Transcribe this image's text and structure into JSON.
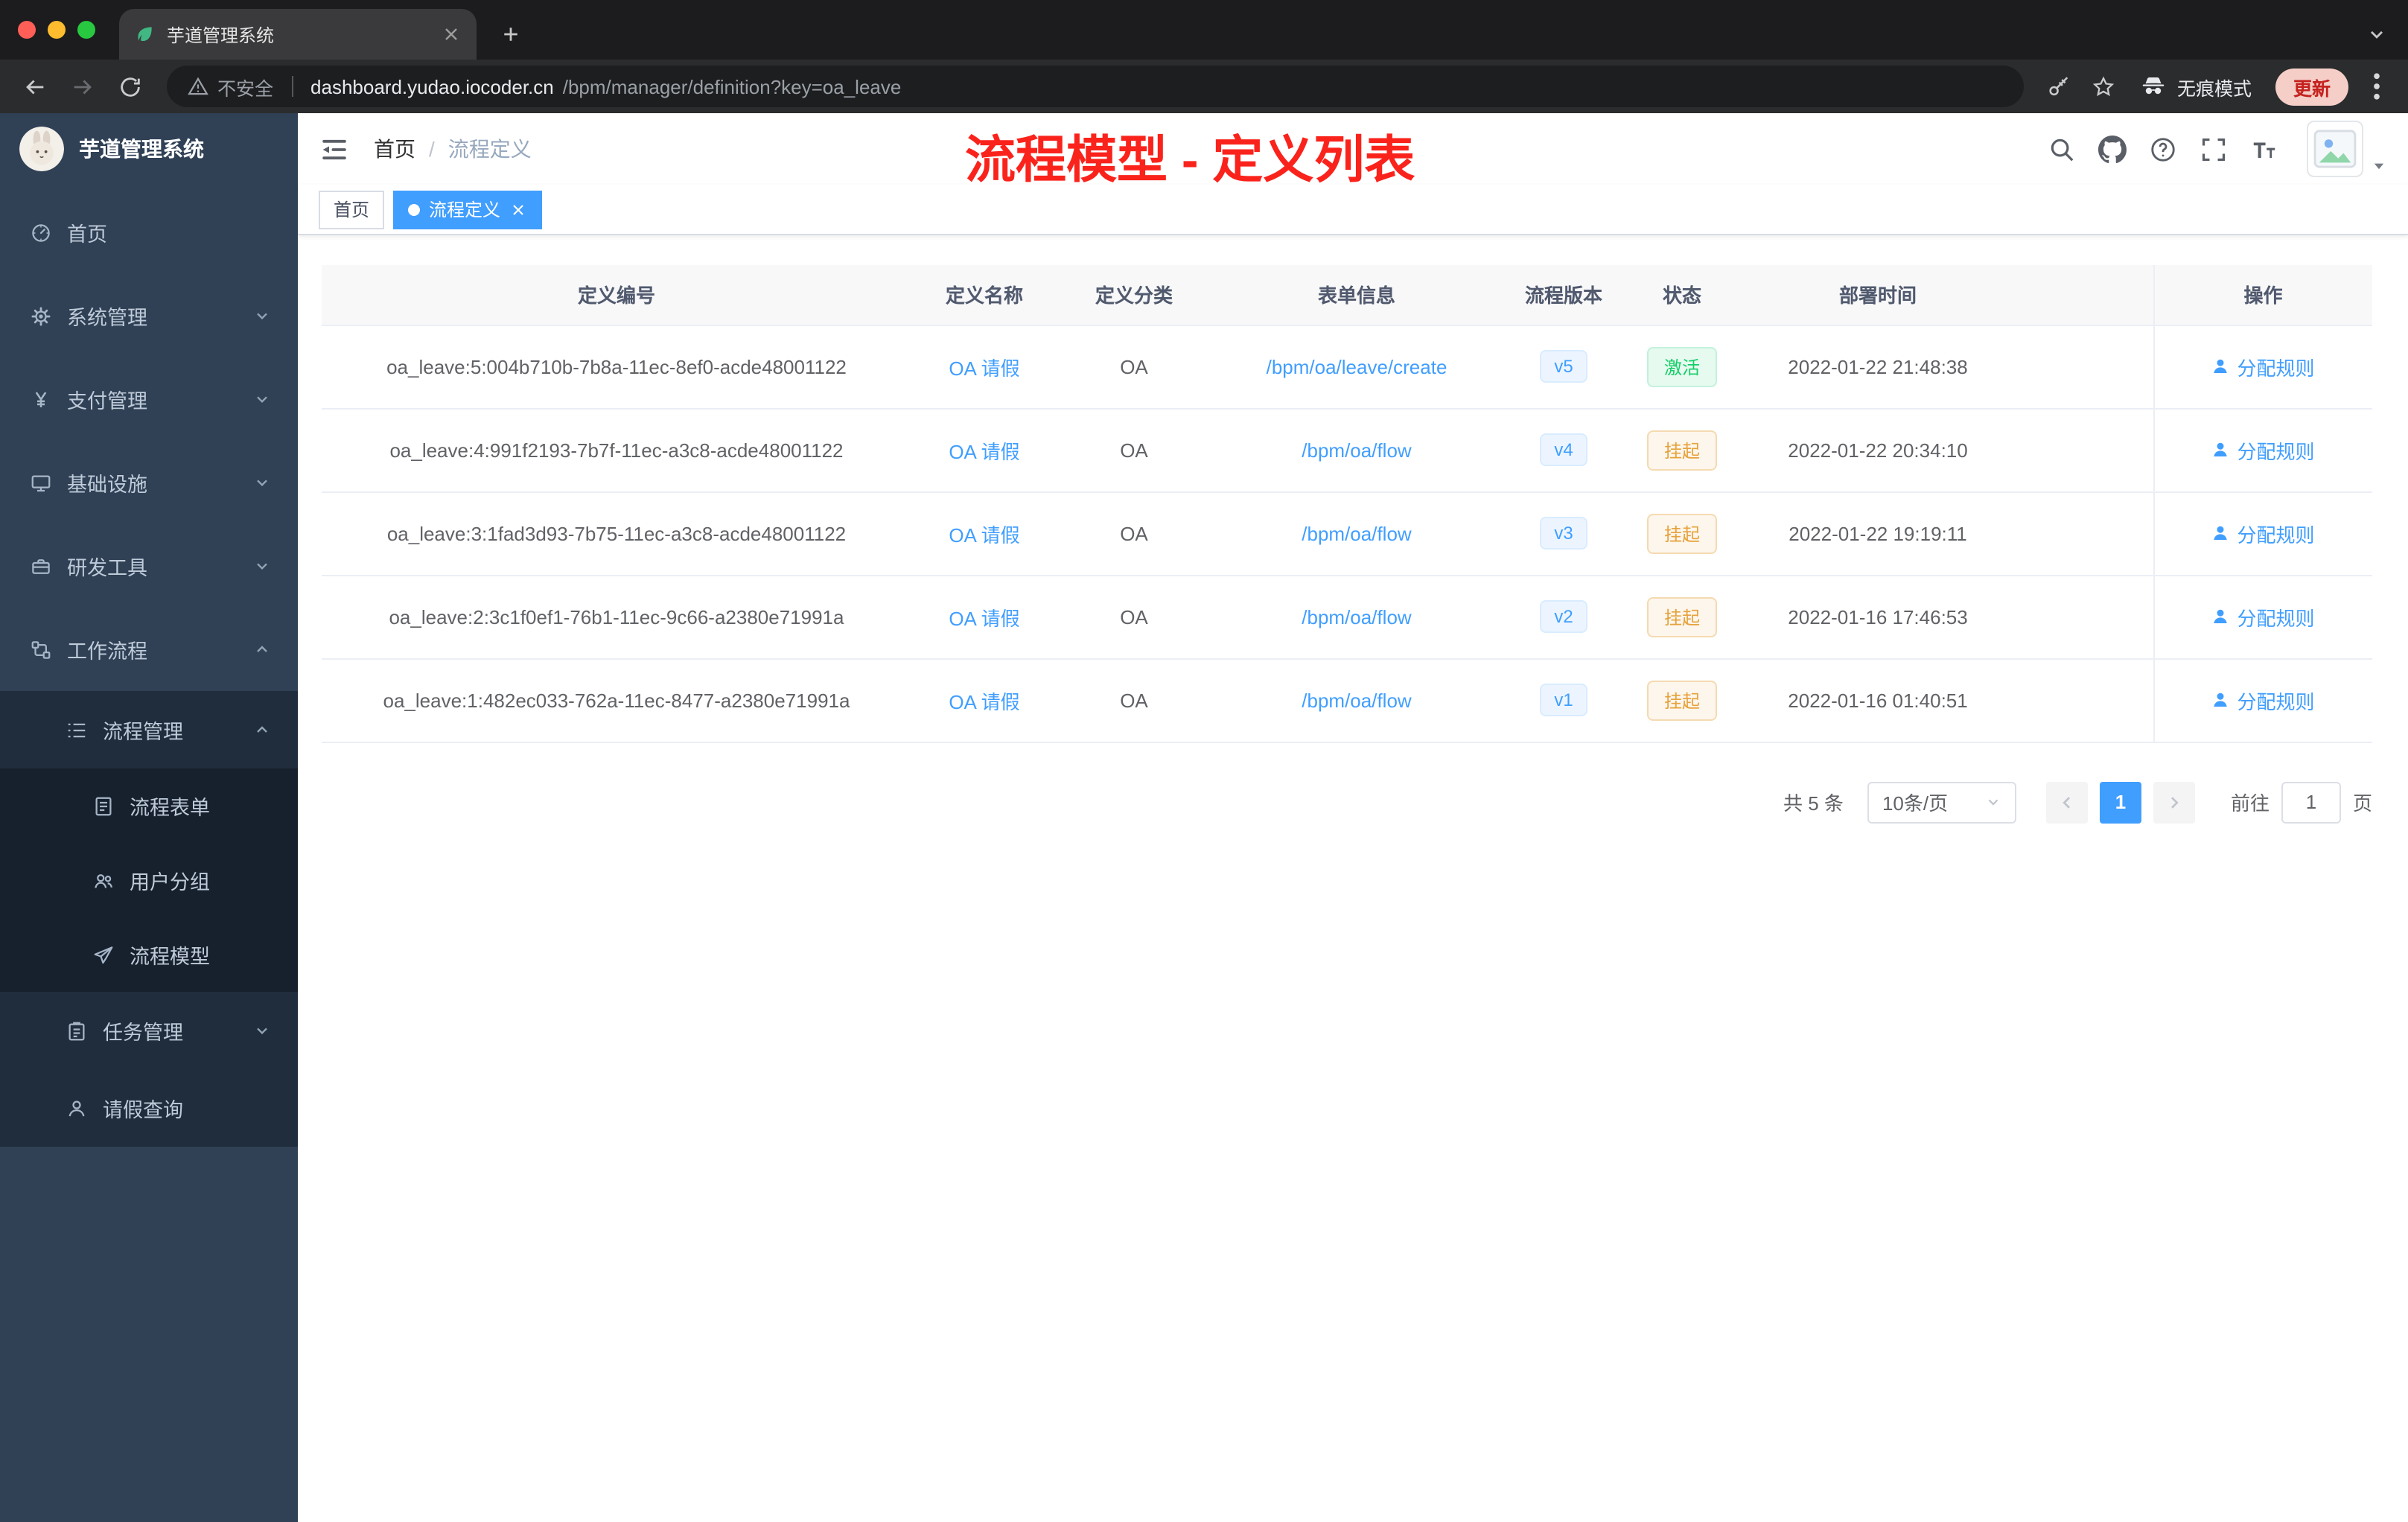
{
  "colors": {
    "accent": "#409eff",
    "sidebar_bg": "#304156",
    "submenu_bg": "#1f2d3d",
    "annotation_red": "#fa231c",
    "status_active_bg": "#e7faf0",
    "status_active_text": "#13ce66",
    "status_suspended_bg": "#fdf6ec",
    "status_suspended_text": "#e6a23c",
    "version_badge_bg": "#ecf5ff",
    "version_badge_text": "#409eff",
    "tag_active_bg": "#409eff"
  },
  "browser": {
    "tab_title": "芋道管理系统",
    "security_label": "不安全",
    "url_host": "dashboard.yudao.iocoder.cn",
    "url_path": "/bpm/manager/definition?key=oa_leave",
    "incognito_label": "无痕模式",
    "update_label": "更新"
  },
  "sidebar": {
    "logo_title": "芋道管理系统",
    "items": [
      {
        "key": "home",
        "label": "首页",
        "icon": "dashboard-icon",
        "level": 1
      },
      {
        "key": "system-management",
        "label": "系统管理",
        "icon": "gear-icon",
        "level": 1,
        "chevron": "down"
      },
      {
        "key": "payment-management",
        "label": "支付管理",
        "icon": "yen-icon",
        "level": 1,
        "chevron": "down"
      },
      {
        "key": "infrastructure",
        "label": "基础设施",
        "icon": "monitor-icon",
        "level": 1,
        "chevron": "down"
      },
      {
        "key": "dev-tools",
        "label": "研发工具",
        "icon": "toolbox-icon",
        "level": 1,
        "chevron": "down"
      },
      {
        "key": "workflow",
        "label": "工作流程",
        "icon": "workflow-icon",
        "level": 1,
        "chevron": "up"
      },
      {
        "key": "process-management",
        "label": "流程管理",
        "icon": "list-settings-icon",
        "level": 2,
        "chevron": "up"
      },
      {
        "key": "process-form",
        "label": "流程表单",
        "icon": "document-icon",
        "level": 3
      },
      {
        "key": "user-group",
        "label": "用户分组",
        "icon": "people-icon",
        "level": 3
      },
      {
        "key": "process-model",
        "label": "流程模型",
        "icon": "paper-plane-icon",
        "level": 3
      },
      {
        "key": "task-management",
        "label": "任务管理",
        "icon": "clipboard-icon",
        "level": 2,
        "chevron": "down"
      },
      {
        "key": "leave-query",
        "label": "请假查询",
        "icon": "person-icon",
        "level": 2
      }
    ]
  },
  "navbar": {
    "breadcrumb": [
      "首页",
      "流程定义"
    ],
    "breadcrumb_separator": "/",
    "annotation": "流程模型 - 定义列表"
  },
  "tags_view": [
    {
      "label": "首页",
      "active": false,
      "closable": false
    },
    {
      "label": "流程定义",
      "active": true,
      "closable": true
    }
  ],
  "table": {
    "columns": [
      "定义编号",
      "定义名称",
      "定义分类",
      "表单信息",
      "流程版本",
      "状态",
      "部署时间",
      "操作"
    ],
    "rows": [
      {
        "id": "oa_leave:5:004b710b-7b8a-11ec-8ef0-acde48001122",
        "name": "OA 请假",
        "category": "OA",
        "form": "/bpm/oa/leave/create",
        "version": "v5",
        "status": "激活",
        "status_type": "success",
        "deploy_time": "2022-01-22 21:48:38",
        "action": "分配规则"
      },
      {
        "id": "oa_leave:4:991f2193-7b7f-11ec-a3c8-acde48001122",
        "name": "OA 请假",
        "category": "OA",
        "form": "/bpm/oa/flow",
        "version": "v4",
        "status": "挂起",
        "status_type": "warning",
        "deploy_time": "2022-01-22 20:34:10",
        "action": "分配规则"
      },
      {
        "id": "oa_leave:3:1fad3d93-7b75-11ec-a3c8-acde48001122",
        "name": "OA 请假",
        "category": "OA",
        "form": "/bpm/oa/flow",
        "version": "v3",
        "status": "挂起",
        "status_type": "warning",
        "deploy_time": "2022-01-22 19:19:11",
        "action": "分配规则"
      },
      {
        "id": "oa_leave:2:3c1f0ef1-76b1-11ec-9c66-a2380e71991a",
        "name": "OA 请假",
        "category": "OA",
        "form": "/bpm/oa/flow",
        "version": "v2",
        "status": "挂起",
        "status_type": "warning",
        "deploy_time": "2022-01-16 17:46:53",
        "action": "分配规则"
      },
      {
        "id": "oa_leave:1:482ec033-762a-11ec-8477-a2380e71991a",
        "name": "OA 请假",
        "category": "OA",
        "form": "/bpm/oa/flow",
        "version": "v1",
        "status": "挂起",
        "status_type": "warning",
        "deploy_time": "2022-01-16 01:40:51",
        "action": "分配规则"
      }
    ]
  },
  "pagination": {
    "total_label": "共 5 条",
    "page_size": "10条/页",
    "current_page": "1",
    "goto_label": "前往",
    "goto_value": "1",
    "page_unit": "页"
  }
}
